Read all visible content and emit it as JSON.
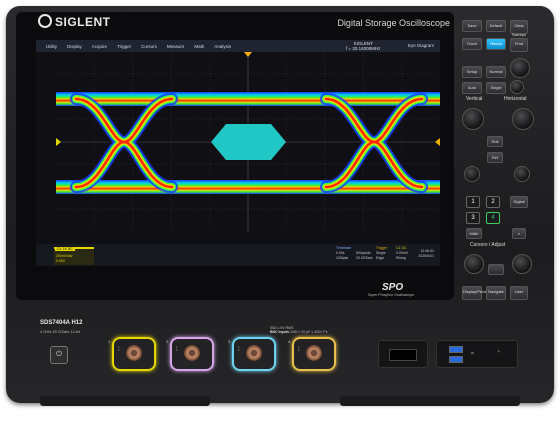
{
  "brand": "SIGLENT",
  "product_name": "Digital Storage Oscilloscope",
  "menu": [
    "Utility",
    "Display",
    "Acquire",
    "Trigger",
    "Cursors",
    "Measure",
    "Math",
    "Analysis"
  ],
  "menu_logo_line1": "SIGLENT",
  "menu_logo_line2": "f = 20.14000MHz",
  "menu_right": "Eye Diagram",
  "channel": {
    "tag": "C1",
    "badge": "1X DC",
    "line1": "200mV/div",
    "line2": "0.00V"
  },
  "timebase": {
    "header": "Timebase",
    "row1": [
      "0.00s",
      "500ps/div"
    ],
    "row2": [
      "100kpts",
      "20.0GSa/s"
    ]
  },
  "trigger": {
    "header": "Trigger",
    "col": "C1 DC",
    "row1": [
      "Single",
      "0.00mV"
    ],
    "row2": [
      "Edge",
      "Rising"
    ]
  },
  "clock": {
    "time": "12:46:01",
    "date": "2025/04/1"
  },
  "spo_logo": "SPO",
  "spo_tagline": "Super Phosphor Oscilloscope",
  "model": "SDS7404A  H12",
  "specs": "4 GHz  20 GSa/s 12-bit",
  "power_icon": "⏻",
  "bnc_info_title": "BNC Inputs",
  "bnc_info_l1": "50Ω ≤ 5V RMS",
  "bnc_info_l2": "1MΩ // 20 pF ≤ 400V Pk",
  "panel": {
    "save": "Save",
    "default": "Default",
    "touch": "Touch",
    "setup": "Setup",
    "auto": "Auto",
    "single": "Single",
    "normal": "Normal",
    "print": "Print",
    "roll": "Roll",
    "history": "History",
    "vertical": "Vertical",
    "horizontal": "Horizontal",
    "math": "Math",
    "ref": "Ref",
    "cursors_adjust": "Cursors / Adjust",
    "nums": [
      "1",
      "2",
      "3",
      "4"
    ],
    "digital": "Digital",
    "display_persist": "Display/Persist",
    "navigate": "Navigate",
    "user": "User",
    "clear": "Clear Sweeps"
  },
  "bnc_numbers": [
    "1",
    "2",
    "3",
    "4"
  ],
  "colors": {
    "ch1": "#e6d600",
    "ch2": "#d7a6e8",
    "ch3": "#6fd3f0",
    "ch4": "#e8c04a",
    "mask": "#20c7c4",
    "accent": "#1ea8e8"
  }
}
